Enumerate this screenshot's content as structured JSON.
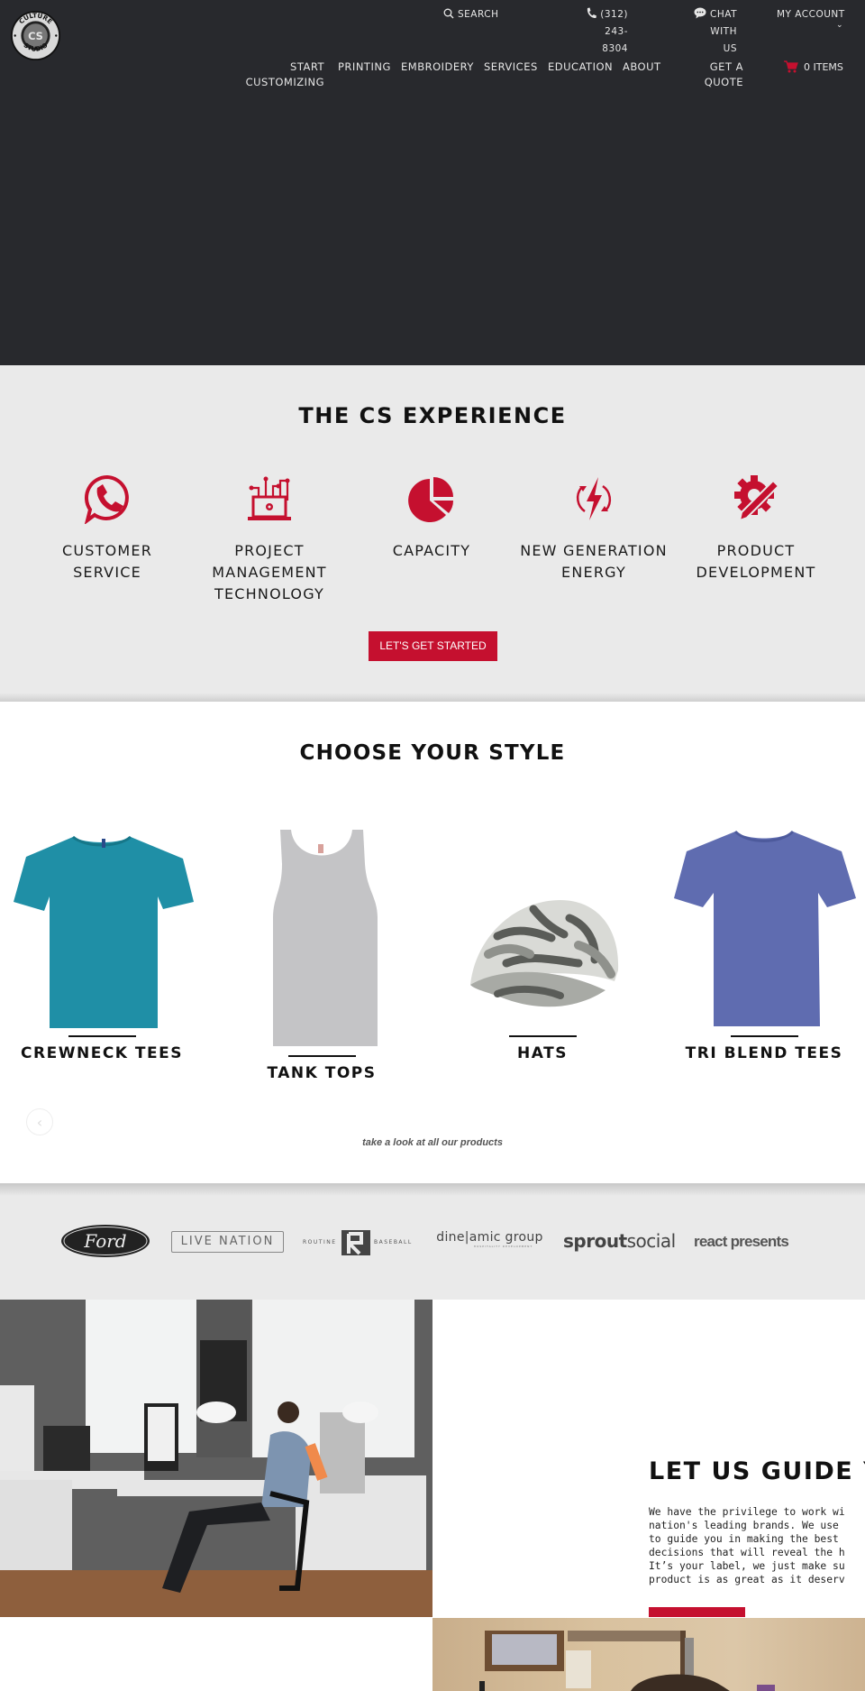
{
  "header": {
    "logo_alt": "Culture Studio",
    "logo_ring_top": "CULTURE",
    "logo_ring_bottom": "STUDIO",
    "logo_mark": "CS",
    "utility": {
      "search_label": "SEARCH",
      "phone_line1": "(312) 243-",
      "phone_line2": "8304",
      "chat_line1": "CHAT WITH",
      "chat_line2": "US",
      "account_label": "MY ACCOUNT"
    },
    "nav": [
      {
        "line1": "START",
        "line2": "CUSTOMIZING"
      },
      {
        "line1": "PRINTING"
      },
      {
        "line1": "EMBROIDERY"
      },
      {
        "line1": "SERVICES"
      },
      {
        "line1": "EDUCATION"
      },
      {
        "line1": "ABOUT"
      },
      {
        "line1": "GET A",
        "line2": "QUOTE"
      }
    ],
    "cart_label": "0 ITEMS",
    "icons": {
      "search": "search-icon",
      "phone": "phone-icon",
      "chat": "chat-bubble-icon",
      "account": "chevron-down-icon",
      "cart": "shopping-cart-icon"
    }
  },
  "experience": {
    "title": "THE CS EXPERIENCE",
    "features": [
      {
        "icon": "phone-chat-icon",
        "line1": "CUSTOMER",
        "line2": "SERVICE"
      },
      {
        "icon": "circuit-laptop-icon",
        "line1": "PROJECT",
        "line2": "MANAGEMENT",
        "line3": "TECHNOLOGY"
      },
      {
        "icon": "pie-chart-icon",
        "line1": "CAPACITY"
      },
      {
        "icon": "lightning-cycle-icon",
        "line1": "NEW GENERATION",
        "line2": "ENERGY"
      },
      {
        "icon": "gear-pencil-icon",
        "line1": "PRODUCT",
        "line2": "DEVELOPMENT"
      }
    ],
    "cta_label": "LET'S GET STARTED"
  },
  "style": {
    "title": "CHOOSE YOUR STYLE",
    "products": [
      {
        "label": "CREWNECK TEES",
        "color": "#1f8fa6"
      },
      {
        "label": "TANK TOPS",
        "color": "#c4c4c6"
      },
      {
        "label": "HATS",
        "color": "#9a9c96"
      },
      {
        "label": "TRI BLEND TEES",
        "color": "#5f6cb0"
      }
    ],
    "prev_arrow": "‹",
    "all_products_link": "take a look at all our products"
  },
  "clients": {
    "logos": [
      {
        "name": "Ford",
        "text": "Ford"
      },
      {
        "name": "Live Nation",
        "text": "LIVE NATION"
      },
      {
        "name": "Routine Baseball",
        "left": "ROUTINE",
        "right": "BASEBALL"
      },
      {
        "name": "Dinamic Group",
        "text": "dine|amic group",
        "sub": "HOSPITALITY DEVELOPMENT"
      },
      {
        "name": "Sprout Social",
        "bold": "sprout",
        "light": "social"
      },
      {
        "name": "React Presents",
        "text": "react presents"
      }
    ]
  },
  "guide": {
    "title": "LET US GUIDE Y",
    "body": "We have the privilege to work wi\nnation's leading brands. We use \nto guide you in making the best \ndecisions that will reveal the h\nIt’s your label, we just make su\nproduct is as great as it deserv"
  },
  "colors": {
    "accent": "#c5102f",
    "header_bg": "#28292d",
    "section_gray": "#eaeaea"
  }
}
